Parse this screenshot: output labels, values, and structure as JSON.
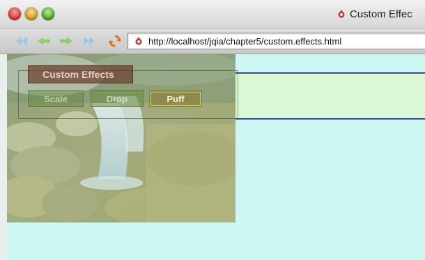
{
  "window": {
    "title": "Custom Effec",
    "controls": [
      "close",
      "minimize",
      "zoom"
    ]
  },
  "toolbar": {
    "buttons": [
      "back-icon",
      "forward-icon",
      "fast-forward-icon",
      "reload-icon"
    ],
    "address": {
      "url": "http://localhost/jqia/chapter5/custom.effects.html",
      "icon": "page-icon"
    }
  },
  "page": {
    "background_color": "#cdf7f3",
    "band_color": "#dbf8d6",
    "band_border_color": "#2f4f8f",
    "image": "waterfall-photo",
    "fieldset": {
      "legend": "Custom Effects",
      "buttons": [
        {
          "label": "Scale",
          "state": "fading"
        },
        {
          "label": "Drop",
          "state": "fading"
        },
        {
          "label": "Puff",
          "state": "normal"
        }
      ]
    }
  }
}
